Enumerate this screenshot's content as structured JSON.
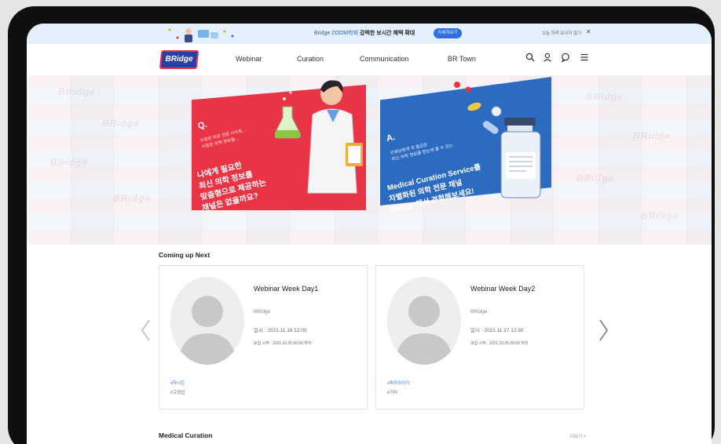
{
  "promo": {
    "text_prefix": "Bridge ZOOM학회 ",
    "text_highlight": "강력한 보시간 혜택 확대",
    "button_label": "자세히보기",
    "close_text": "오늘 하루 보이지 않기",
    "close_label": "✕"
  },
  "header": {
    "logo": "BRidge",
    "nav": [
      "Webinar",
      "Curation",
      "Communication",
      "BR Town"
    ],
    "icons": [
      "search-icon",
      "user-icon",
      "chat-icon",
      "menu-icon"
    ]
  },
  "hero": {
    "watermark": "BRidge",
    "red_banner": {
      "mark": "Q.",
      "sub_line1": "수많은 의료 전문 사이트…",
      "sub_line2": "수많은 의학 정보들…",
      "line1": "나에게 필요한",
      "line2": "최신 의학 정보를",
      "line3": "맞춤형으로 제공하는",
      "line4": "채널은 없을까요?"
    },
    "blue_banner": {
      "mark": "A.",
      "sub_line1": "선생님에게 꼭 필요한",
      "sub_line2": "최신 의학 정보를 한눈에 볼 수 있는",
      "line1": "Medical Curation Service를",
      "line2": "차별화된 의학 전문 채널",
      "line3": "BRidge에서 경험해보세요!"
    }
  },
  "coming_up": {
    "title": "Coming up Next",
    "cards": [
      {
        "title": "Webinar Week Day1",
        "org": "BRidge",
        "date": "일시 : 2021.11.16 12:00",
        "reg": "모집 시작 : 2021.10.25 00:00 까지",
        "tag": "#하나은",
        "host": "#고정업"
      },
      {
        "title": "Webinar Week Day2",
        "org": "BRidge",
        "date": "일시 : 2021.11.17 12:30",
        "reg": "모집 시작 : 2021.10.25 00:00 까지",
        "tag": "#파트아이기",
        "host": "#기타"
      }
    ]
  },
  "medical_curation": {
    "title": "Medical Curation",
    "more": "더보기 >"
  },
  "colors": {
    "brand_blue": "#2c6cc0",
    "brand_red": "#e83444",
    "promo_bg": "#e4f0fb"
  }
}
